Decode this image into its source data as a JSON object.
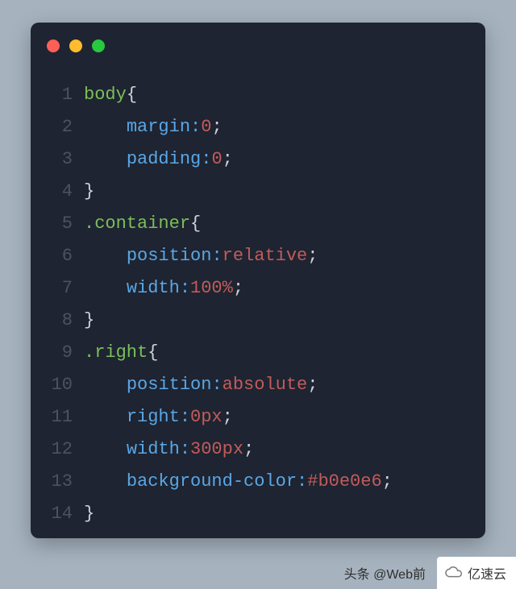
{
  "window": {
    "dots": [
      "red",
      "yellow",
      "green"
    ]
  },
  "code": {
    "lines": [
      {
        "n": "1",
        "tokens": [
          {
            "t": "body",
            "c": "sel"
          },
          {
            "t": "{",
            "c": "punc"
          }
        ]
      },
      {
        "n": "2",
        "tokens": [
          {
            "t": "    ",
            "c": "sp"
          },
          {
            "t": "margin",
            "c": "prop"
          },
          {
            "t": ":",
            "c": "colon"
          },
          {
            "t": "0",
            "c": "val"
          },
          {
            "t": ";",
            "c": "punc"
          }
        ]
      },
      {
        "n": "3",
        "tokens": [
          {
            "t": "    ",
            "c": "sp"
          },
          {
            "t": "padding",
            "c": "prop"
          },
          {
            "t": ":",
            "c": "colon"
          },
          {
            "t": "0",
            "c": "val"
          },
          {
            "t": ";",
            "c": "punc"
          }
        ]
      },
      {
        "n": "4",
        "tokens": [
          {
            "t": "}",
            "c": "punc"
          }
        ]
      },
      {
        "n": "5",
        "tokens": [
          {
            "t": ".container",
            "c": "sel"
          },
          {
            "t": "{",
            "c": "punc"
          }
        ]
      },
      {
        "n": "6",
        "tokens": [
          {
            "t": "    ",
            "c": "sp"
          },
          {
            "t": "position",
            "c": "prop"
          },
          {
            "t": ":",
            "c": "colon"
          },
          {
            "t": "relative",
            "c": "val"
          },
          {
            "t": ";",
            "c": "punc"
          }
        ]
      },
      {
        "n": "7",
        "tokens": [
          {
            "t": "    ",
            "c": "sp"
          },
          {
            "t": "width",
            "c": "prop"
          },
          {
            "t": ":",
            "c": "colon"
          },
          {
            "t": "100%",
            "c": "val"
          },
          {
            "t": ";",
            "c": "punc"
          }
        ]
      },
      {
        "n": "8",
        "tokens": [
          {
            "t": "}",
            "c": "punc"
          }
        ]
      },
      {
        "n": "9",
        "tokens": [
          {
            "t": ".right",
            "c": "sel"
          },
          {
            "t": "{",
            "c": "punc"
          }
        ]
      },
      {
        "n": "10",
        "tokens": [
          {
            "t": "    ",
            "c": "sp"
          },
          {
            "t": "position",
            "c": "prop"
          },
          {
            "t": ":",
            "c": "colon"
          },
          {
            "t": "absolute",
            "c": "val"
          },
          {
            "t": ";",
            "c": "punc"
          }
        ]
      },
      {
        "n": "11",
        "tokens": [
          {
            "t": "    ",
            "c": "sp"
          },
          {
            "t": "right",
            "c": "prop"
          },
          {
            "t": ":",
            "c": "colon"
          },
          {
            "t": "0px",
            "c": "val"
          },
          {
            "t": ";",
            "c": "punc"
          }
        ]
      },
      {
        "n": "12",
        "tokens": [
          {
            "t": "    ",
            "c": "sp"
          },
          {
            "t": "width",
            "c": "prop"
          },
          {
            "t": ":",
            "c": "colon"
          },
          {
            "t": "300px",
            "c": "val"
          },
          {
            "t": ";",
            "c": "punc"
          }
        ]
      },
      {
        "n": "13",
        "tokens": [
          {
            "t": "    ",
            "c": "sp"
          },
          {
            "t": "background-color",
            "c": "prop"
          },
          {
            "t": ":",
            "c": "colon"
          },
          {
            "t": "#b0e0e6",
            "c": "val"
          },
          {
            "t": ";",
            "c": "punc"
          }
        ]
      },
      {
        "n": "14",
        "tokens": [
          {
            "t": "}",
            "c": "punc"
          }
        ]
      }
    ]
  },
  "footer": {
    "attribution": "头条 @Web前",
    "brand": "亿速云"
  }
}
